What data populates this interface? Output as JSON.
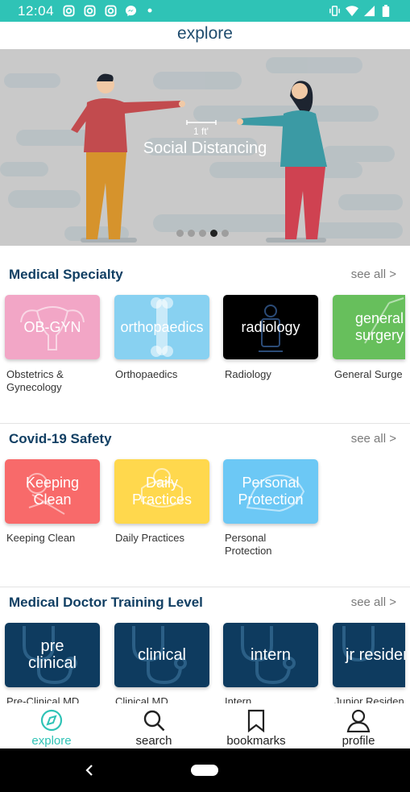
{
  "status_bar": {
    "time": "12:04",
    "left_icons": [
      "instagram-icon",
      "instagram-icon",
      "instagram-icon",
      "messenger-icon",
      "dot-icon"
    ],
    "right_icons": [
      "vibrate-icon",
      "wifi-icon",
      "signal-icon",
      "battery-icon"
    ]
  },
  "header": {
    "title": "explore"
  },
  "banner": {
    "title": "Social Distancing",
    "measure": "1 ft'",
    "dots": {
      "count": 5,
      "active_index": 3
    }
  },
  "sections": [
    {
      "title": "Medical Specialty",
      "see_all": "see all >",
      "cards": [
        {
          "label": "OB-GYN",
          "caption": "Obstetrics & Gynecology",
          "color": "#f2a6c6"
        },
        {
          "label": "orthopaedics",
          "caption": "Orthopaedics",
          "color": "#88d1f1"
        },
        {
          "label": "radiology",
          "caption": "Radiology",
          "color": "#000000"
        },
        {
          "label": "general surgery",
          "caption": "General Surge",
          "color": "#67bf5c"
        }
      ]
    },
    {
      "title": "Covid-19 Safety",
      "see_all": "see all >",
      "cards": [
        {
          "label": "Keeping Clean",
          "caption": "Keeping Clean",
          "color": "#f86a6a"
        },
        {
          "label": "Daily Practices",
          "caption": "Daily Practices",
          "color": "#ffd84d"
        },
        {
          "label": "Personal Protection",
          "caption": "Personal Protection",
          "color": "#6cc8f5"
        }
      ]
    },
    {
      "title": "Medical Doctor Training Level",
      "see_all": "see all >",
      "cards": [
        {
          "label": "pre clinical",
          "caption": "Pre-Clinical MD",
          "color": "#0e3b5f"
        },
        {
          "label": "clinical",
          "caption": "Clinical MD",
          "color": "#0e3b5f"
        },
        {
          "label": "intern",
          "caption": "Intern",
          "color": "#0e3b5f"
        },
        {
          "label": "jr residen",
          "caption": "Junior Residen",
          "color": "#0e3b5f"
        }
      ]
    }
  ],
  "bottom_nav": {
    "items": [
      {
        "label": "explore",
        "icon": "compass-icon",
        "active": true
      },
      {
        "label": "search",
        "icon": "search-icon",
        "active": false
      },
      {
        "label": "bookmarks",
        "icon": "bookmark-icon",
        "active": false
      },
      {
        "label": "profile",
        "icon": "profile-icon",
        "active": false
      }
    ]
  },
  "colors": {
    "accent": "#2fc3b6",
    "heading": "#113f63",
    "banner_bg": "#c9c9c9"
  }
}
